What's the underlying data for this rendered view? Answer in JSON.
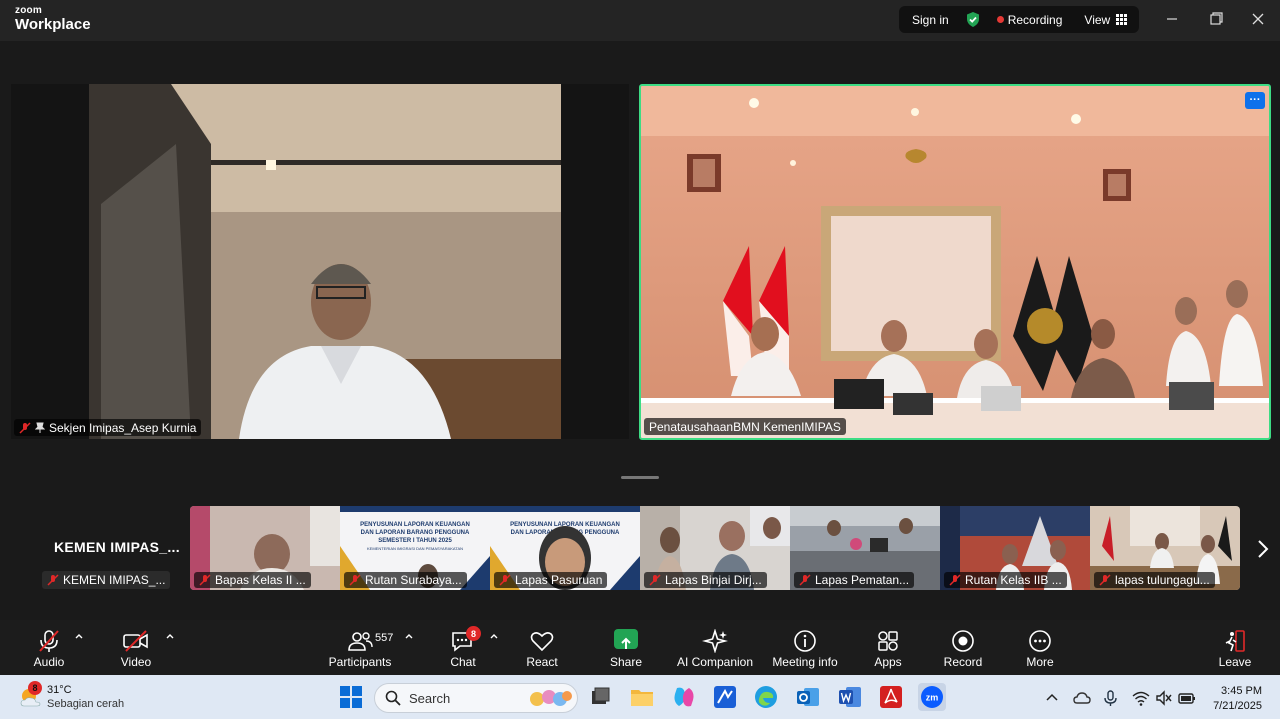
{
  "app": {
    "logo_line1": "zoom",
    "logo_line2": "Workplace"
  },
  "titlebar": {
    "sign_in": "Sign in",
    "recording": "Recording",
    "view": "View"
  },
  "colors": {
    "active_speaker_border": "#3ddc84",
    "recording_dot": "#e53935",
    "share_green": "#22a454",
    "badge_red": "#e02828",
    "accent_blue": "#0e71eb"
  },
  "main_videos": [
    {
      "name": "Sekjen Imipas_Asep Kurnia",
      "muted": true,
      "pinned": true
    },
    {
      "name": "PenatausahaanBMN KemenIMIPAS",
      "active_speaker": true,
      "more_label": "···"
    }
  ],
  "self_tile": {
    "display_name": "KEMEN  IMIPAS_...",
    "label": "KEMEN IMIPAS_..."
  },
  "thumbnails": [
    {
      "name": "Bapas Kelas II ..."
    },
    {
      "name": "Rutan Surabaya..."
    },
    {
      "name": "Lapas Pasuruan"
    },
    {
      "name": "Lapas Binjai Dirj..."
    },
    {
      "name": "Lapas Pematan..."
    },
    {
      "name": "Rutan Kelas IIB ..."
    },
    {
      "name": "lapas tulungagu..."
    }
  ],
  "slide_text": {
    "line1": "PENYUSUNAN LAPORAN KEUANGAN",
    "line2": "DAN LAPORAN BARANG PENGGUNA",
    "line3": "SEMESTER I TAHUN 2025",
    "line4": "KEMENTERIAN IMIGRASI DAN PEMASYARAKATAN"
  },
  "toolbar": {
    "audio": "Audio",
    "video": "Video",
    "participants": "Participants",
    "participants_count": "557",
    "chat": "Chat",
    "chat_badge": "8",
    "react": "React",
    "share": "Share",
    "ai_companion": "AI Companion",
    "meeting_info": "Meeting info",
    "apps": "Apps",
    "record": "Record",
    "more": "More",
    "leave": "Leave"
  },
  "taskbar": {
    "weather_badge": "8",
    "temperature": "31°C",
    "weather_desc": "Sebagian cerah",
    "search_placeholder": "Search",
    "time": "3:45 PM",
    "date": "7/21/2025"
  }
}
